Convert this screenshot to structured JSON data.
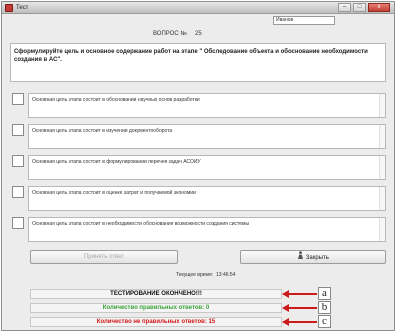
{
  "window": {
    "title": "Тест",
    "minimize_glyph": "–",
    "maximize_glyph": "□",
    "close_glyph": "x"
  },
  "header": {
    "name_field_value": "Иванов",
    "question_label": "ВОПРОС №",
    "question_number": "25"
  },
  "question": {
    "text": "Сформулируйте цель и основное содержание работ на этапе \" Обследование объекта и обоснование необходимости создания в АС\"."
  },
  "answers": [
    {
      "text": "Основная цель этапа состоит в обосновании научных основ разработки"
    },
    {
      "text": "Основная цель этапа состоит в изучении документооборота"
    },
    {
      "text": "Основная цель этапа состоит в формулировании перечня задач АСОИУ"
    },
    {
      "text": "Основная цель этапа состоит в оценке затрат и получаемой экономии"
    },
    {
      "text": "Основная цель этапа состоит в необходимости обоснования возможности создания системы"
    }
  ],
  "buttons": {
    "accept_label": "Принять ответ",
    "close_label": "Закрыть",
    "close_icon": "person-exit-icon"
  },
  "time": {
    "label": "Текущее время:",
    "value": "13:46:54"
  },
  "results": {
    "finished_text": "ТЕСТИРОВАНИЕ ОКОНЧЕНО!!!",
    "correct_text": "Количество правильных ответов: 0",
    "incorrect_text": "Количество не правильных ответов: 15"
  },
  "callouts": [
    "a",
    "b",
    "c"
  ],
  "colors": {
    "finished": "#111111",
    "correct": "#3aa23a",
    "incorrect": "#d01818",
    "arrow": "#cc1b1b"
  }
}
